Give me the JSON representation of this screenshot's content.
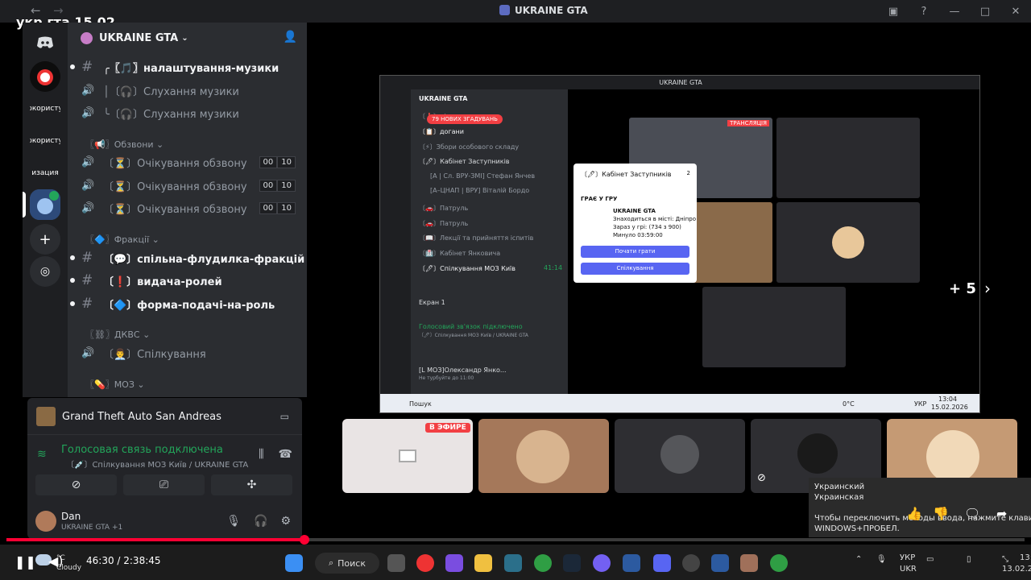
{
  "video_overlay_title": "укр гта 15.02",
  "window": {
    "title": "UKRAINE GTA"
  },
  "server": {
    "name": "UKRAINE GTA"
  },
  "rail": {
    "labels": [
      "ркористу",
      "ркористу",
      "изация"
    ]
  },
  "channels": [
    {
      "type": "text",
      "label": "╭〖🎵〗налаштування-музики",
      "unread": true
    },
    {
      "type": "voice",
      "label": "│〔🎧〕Слухання музики"
    },
    {
      "type": "voice",
      "label": "╰〔🎧〕Слухання музики"
    }
  ],
  "categories": {
    "calls": "〖📢〗Обзвони",
    "factions": "〖🔷〗Фракції",
    "dkvs": "〖⛓〗ДКВС",
    "moz": "〖💊〗МОЗ"
  },
  "waiting_channels": [
    {
      "label": "〔⏳〕Очікування обзвону",
      "count_a": "00",
      "count_b": "10"
    },
    {
      "label": "〔⏳〕Очікування обзвону",
      "count_a": "00",
      "count_b": "10"
    },
    {
      "label": "〔⏳〕Очікування обзвону",
      "count_a": "00",
      "count_b": "10"
    }
  ],
  "faction_channels": [
    {
      "label": "〔💬〕спільна-флудилка-фракцій"
    },
    {
      "label": "〔❗〕видача-ролей"
    },
    {
      "label": "〔🔷〕форма-подачі-на-роль"
    }
  ],
  "dkvs_channel": "〔👨‍💼〕Спілкування",
  "activity": {
    "title": "Grand Theft Auto San Andreas"
  },
  "voice": {
    "status": "Голосовая связь подключена",
    "channel": "〔💉〕Спілкування МОЗ Київ / UKRAINE GTA"
  },
  "user": {
    "name": "Dan",
    "status": "UKRAINE GTA +1"
  },
  "inner": {
    "title": "UKRAINE GTA",
    "server": "UKRAINE GTA",
    "mentions_badge": "79 НОВИХ ЗГАДУВАНЬ",
    "rows": [
      "〔❗〕підвищення",
      "〔📋〕догани",
      "〔⚡〕Збори особового складу",
      "〔🖊〕Кабінет Заступників",
      "[А | Сл. ВРУ-ЗМІ] Стефан Янчев",
      "[А–ЦНАП | ВРУ] Віталій Бордо",
      "〔🚗〕Патруль",
      "〔🚗〕Патруль",
      "〔📖〕Лекції та прийняття іспитів",
      "〔🏥〕Кабінет Янковича",
      "〔🖊〕Спілкування МОЗ Київ"
    ],
    "live_tag": "ТРАНСЛЯЦІЯ",
    "screen_label": "Екран 1",
    "voice_status": "Голосовий зв'язок підключено",
    "voice_channel": "〔🖊〕Спілкування МОЗ Київ / UKRAINE GTA",
    "user_name": "[L МОЗ]Олександр Янко...",
    "user_status": "Не турбуйте до 11:00",
    "taskbar_search": "Пошук",
    "clock": "13:04",
    "date": "15.02.2026",
    "lang": "УКР",
    "temp": "0°C",
    "timer": "41:14"
  },
  "popup": {
    "channel": "〔🖊〕Кабінет Заступників",
    "count": "2",
    "playing": "ГРАЄ У ГРУ",
    "game": "UKRAINE GTA",
    "line1": "Знаходиться в місті: Дніпро",
    "line2": "Зараз у грі: (734 з 900)",
    "line3": "Минуло 03:59:00",
    "btn_play": "Почати грати",
    "btn_talk": "Спілкування"
  },
  "more_count": "+ 5",
  "live_badge": "В ЭФИРЕ",
  "toast": {
    "line1": "Украинский",
    "line2": "Украинская",
    "line3": "Чтобы переключить методы ввода, нажмите клавиши",
    "line4": "WINDOWS+ПРОБЕЛ."
  },
  "player": {
    "time": "46:30 / 2:38:45",
    "progress": 0.293
  },
  "weather": {
    "temp": "°C",
    "cond": "Cloudy"
  },
  "taskbar": {
    "search": "Поиск",
    "lang1": "УКР",
    "lang2": "UKR",
    "clock": "13:",
    "date": "13.02.20"
  },
  "colors": {
    "accent": "#5865f2",
    "green": "#23a55a",
    "red": "#f23f43",
    "sidebar": "#2b2d31"
  }
}
